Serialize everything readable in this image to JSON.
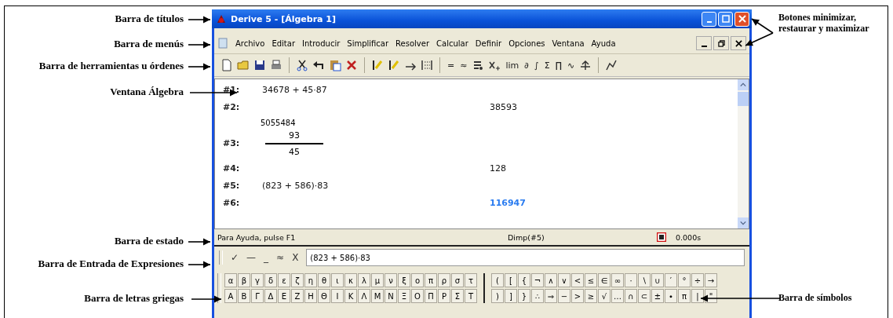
{
  "window": {
    "title": "Derive 5 - [Álgebra 1]"
  },
  "menu": {
    "items": [
      "Archivo",
      "Editar",
      "Introducir",
      "Simplificar",
      "Resolver",
      "Calcular",
      "Definir",
      "Opciones",
      "Ventana",
      "Ayuda"
    ]
  },
  "toolbar": {
    "items": [
      {
        "kind": "icon"
      },
      {
        "kind": "icon"
      },
      {
        "kind": "icon"
      },
      {
        "kind": "icon"
      },
      {
        "kind": "separator"
      },
      {
        "kind": "icon"
      },
      {
        "kind": "icon"
      },
      {
        "kind": "icon"
      },
      {
        "kind": "icon"
      },
      {
        "kind": "separator"
      },
      {
        "kind": "icon"
      },
      {
        "kind": "icon"
      },
      {
        "kind": "icon"
      },
      {
        "kind": "icon"
      },
      {
        "kind": "separator"
      },
      {
        "kind": "symbol",
        "text": "="
      },
      {
        "kind": "symbol",
        "text": "≈"
      },
      {
        "kind": "icon"
      },
      {
        "kind": "icon"
      },
      {
        "kind": "symbol",
        "text": "lim"
      },
      {
        "kind": "symbol",
        "text": "∂"
      },
      {
        "kind": "symbol",
        "text": "∫"
      },
      {
        "kind": "symbol",
        "text": "Σ"
      },
      {
        "kind": "symbol",
        "text": "∏"
      },
      {
        "kind": "symbol",
        "text": "∿"
      },
      {
        "kind": "icon"
      },
      {
        "kind": "separator"
      },
      {
        "kind": "icon"
      }
    ]
  },
  "algebra": {
    "expressions": [
      {
        "kind": "input",
        "label": "#1:",
        "text": "34678 + 45·87",
        "selected": false
      },
      {
        "kind": "result",
        "label": "#2:",
        "text": "38593",
        "selected": false
      },
      {
        "kind": "fraction",
        "label": "#3:",
        "above": "5055484",
        "numerator": "93",
        "denominator": "45",
        "selected": false
      },
      {
        "kind": "result",
        "label": "#4:",
        "text": "128",
        "selected": false
      },
      {
        "kind": "input",
        "label": "#5:",
        "text": "(823 + 586)·83",
        "selected": false
      },
      {
        "kind": "result",
        "label": "#6:",
        "text": "116947",
        "selected": true
      }
    ]
  },
  "status_bar": {
    "hint": "Para Ayuda, pulse F1",
    "command": "Dimp(#5)",
    "time": "0.000s"
  },
  "entry_bar": {
    "buttons": [
      "✓",
      "—",
      "_",
      "≈",
      "X"
    ],
    "value": "(823 + 586)·83"
  },
  "greek_bar": {
    "rows": [
      [
        "α",
        "β",
        "γ",
        "δ",
        "ε",
        "ζ",
        "η",
        "θ",
        "ι",
        "κ",
        "λ",
        "μ",
        "ν",
        "ξ",
        "ο",
        "π",
        "ρ",
        "σ",
        "τ"
      ],
      [
        "Α",
        "Β",
        "Γ",
        "Δ",
        "Ε",
        "Ζ",
        "Η",
        "Θ",
        "Ι",
        "Κ",
        "Λ",
        "Μ",
        "Ν",
        "Ξ",
        "Ο",
        "Π",
        "Ρ",
        "Σ",
        "Τ"
      ]
    ]
  },
  "symbol_bar": {
    "rows": [
      [
        "(",
        "[",
        "{",
        "¬",
        "∧",
        "∨",
        "<",
        "≤",
        "∈",
        "∞",
        "·",
        "∖",
        "∪",
        "′",
        "°",
        "÷",
        "→"
      ],
      [
        ")",
        "]",
        "}",
        "∴",
        "⇒",
        "−",
        ">",
        "≥",
        "√",
        "…",
        "∩",
        "⊂",
        "±",
        "∙",
        "π",
        "|",
        "\""
      ]
    ]
  },
  "annotations": [
    {
      "text": "Barra de títulos"
    },
    {
      "text": "Barra de menús"
    },
    {
      "text": "Barra de herramientas u órdenes"
    },
    {
      "text": "Ventana Álgebra"
    },
    {
      "text": "Barra de estado"
    },
    {
      "text": "Barra de Entrada de Expresiones"
    },
    {
      "text": "Barra de letras griegas"
    },
    {
      "text": "Botones minimizar, restaurar y maximizar"
    },
    {
      "text": "Barra de símbolos"
    }
  ]
}
